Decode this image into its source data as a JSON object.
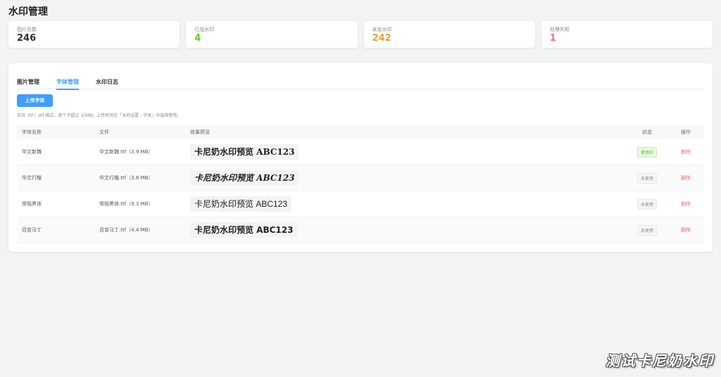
{
  "page": {
    "title": "水印管理"
  },
  "stats": [
    {
      "label": "图片总数",
      "value": "246",
      "color": "#303133"
    },
    {
      "label": "已加水印",
      "value": "4",
      "color": "#67c23a"
    },
    {
      "label": "未加水印",
      "value": "242",
      "color": "#e6a23c"
    },
    {
      "label": "处理失败",
      "value": "1",
      "color": "#f56c6c"
    }
  ],
  "tabs": [
    {
      "label": "图片管理",
      "active": false
    },
    {
      "label": "字体管理",
      "active": true
    },
    {
      "label": "水印日志",
      "active": false
    }
  ],
  "upload": {
    "label": "上传字体"
  },
  "hint": "支持 .ttf / .otf 格式，单个不超过 10MB；上传后可在「水印设置 - 字体」中选择使用。",
  "table": {
    "headers": {
      "name": "字体名称",
      "file": "文件",
      "preview": "效果预览",
      "status": "状态",
      "op": "操作"
    },
    "rows": [
      {
        "name": "华文新魏",
        "file": "华文新魏.ttf（3.9 MB）",
        "preview": "卡尼奶水印预览 ABC123",
        "status": "使用中",
        "in_use": true,
        "op": "删除"
      },
      {
        "name": "华文行楷",
        "file": "华文行楷.ttf（3.8 MB）",
        "preview": "卡尼奶水印预览 ABC123",
        "status": "未使用",
        "in_use": false,
        "op": "删除"
      },
      {
        "name": "常规黑体",
        "file": "常规黑体.ttf（9.3 MB）",
        "preview": "卡尼奶水印预览 ABC123",
        "status": "未使用",
        "in_use": false,
        "op": "删除"
      },
      {
        "name": "百变马丁",
        "file": "百变马丁.ttf（4.4 MB）",
        "preview": "卡尼奶水印预览 ABC123",
        "status": "未使用",
        "in_use": false,
        "op": "删除"
      }
    ]
  },
  "watermark": {
    "text": "测试卡尼奶水印"
  }
}
